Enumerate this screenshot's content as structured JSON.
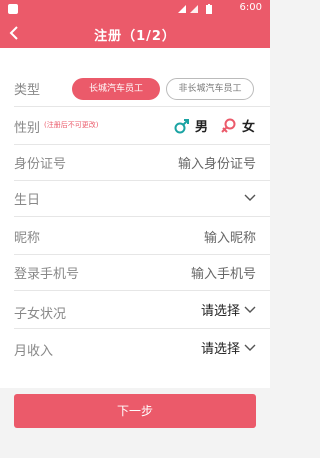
{
  "status": {
    "time": "6:00"
  },
  "header": {
    "title": "注册（1/2）"
  },
  "form": {
    "type": {
      "label": "类型",
      "option_selected": "长城汽车员工",
      "option_other": "非长城汽车员工"
    },
    "gender": {
      "label": "性别",
      "hint": "(注册后不可更改)",
      "male": "男",
      "female": "女"
    },
    "id_number": {
      "label": "身份证号",
      "placeholder": "输入身份证号"
    },
    "birthday": {
      "label": "生日"
    },
    "nickname": {
      "label": "昵称",
      "placeholder": "输入昵称"
    },
    "phone": {
      "label": "登录手机号",
      "placeholder": "输入手机号"
    },
    "children": {
      "label": "子女状况",
      "value": "请选择"
    },
    "income": {
      "label": "月收入",
      "value": "请选择"
    }
  },
  "footer": {
    "next_label": "下一步"
  },
  "colors": {
    "accent": "#eb5a6a",
    "male": "#1aa3a3"
  }
}
